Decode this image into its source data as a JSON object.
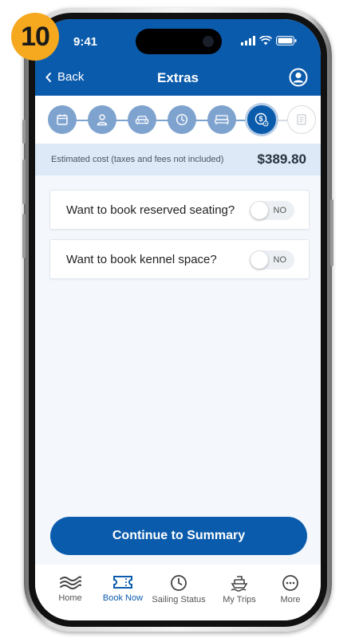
{
  "badge": {
    "number": "10"
  },
  "status_bar": {
    "time": "9:41"
  },
  "header": {
    "back_label": "Back",
    "title": "Extras"
  },
  "steps": [
    {
      "icon": "calendar-icon",
      "state": "done"
    },
    {
      "icon": "person-icon",
      "state": "done"
    },
    {
      "icon": "car-icon",
      "state": "done"
    },
    {
      "icon": "clock-icon",
      "state": "done"
    },
    {
      "icon": "bed-icon",
      "state": "done"
    },
    {
      "icon": "dollar-icon",
      "state": "active"
    },
    {
      "icon": "summary-icon",
      "state": "inactive"
    }
  ],
  "cost": {
    "label": "Estimated cost (taxes and fees not included)",
    "value": "$389.80"
  },
  "options": [
    {
      "label": "Want to book reserved seating?",
      "toggle": "NO"
    },
    {
      "label": "Want to book kennel space?",
      "toggle": "NO"
    }
  ],
  "cta": {
    "label": "Continue to Summary"
  },
  "tabs": [
    {
      "label": "Home",
      "icon": "waves-icon",
      "active": false
    },
    {
      "label": "Book Now",
      "icon": "ticket-icon",
      "active": true
    },
    {
      "label": "Sailing Status",
      "icon": "clock-icon",
      "active": false
    },
    {
      "label": "My Trips",
      "icon": "ferry-icon",
      "active": false
    },
    {
      "label": "More",
      "icon": "more-icon",
      "active": false
    }
  ],
  "colors": {
    "brand": "#0b5bac",
    "badge": "#f6a81f",
    "step_done": "#7fa3cf"
  }
}
